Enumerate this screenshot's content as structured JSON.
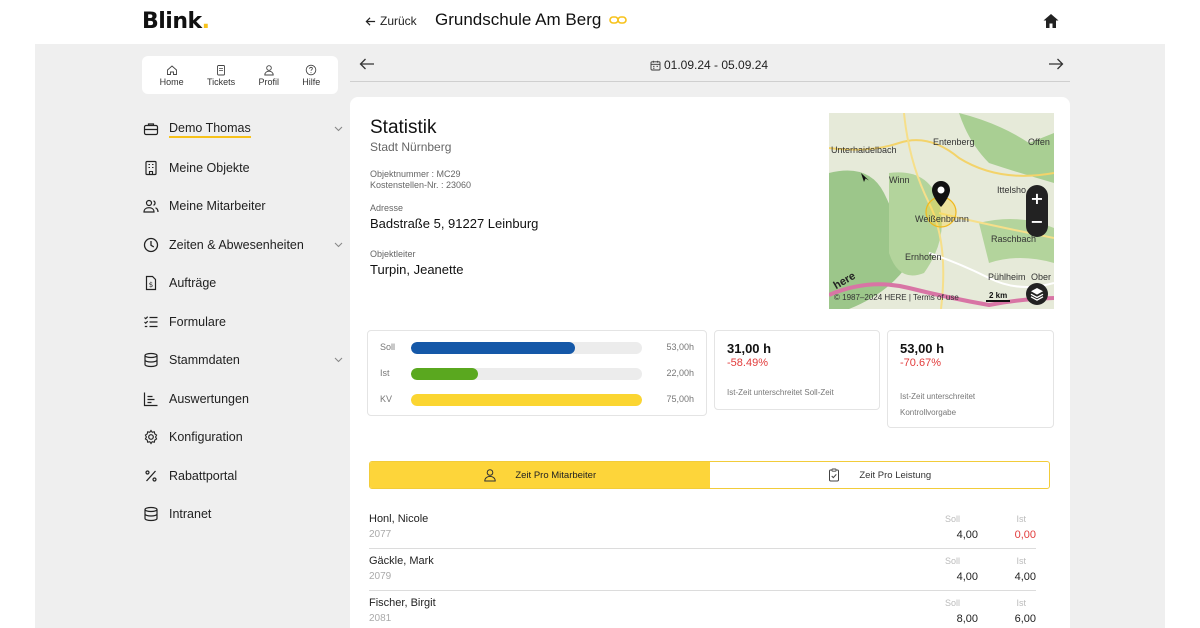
{
  "header": {
    "logo_text": "Blink",
    "logo_dot": ".",
    "back_label": "Zurück",
    "title": "Grundschule Am Berg"
  },
  "quicknav": [
    {
      "label": "Home",
      "icon": "home-icon"
    },
    {
      "label": "Tickets",
      "icon": "tickets-icon"
    },
    {
      "label": "Profil",
      "icon": "profile-icon"
    },
    {
      "label": "Hilfe",
      "icon": "help-icon"
    }
  ],
  "sidebar": {
    "items": [
      {
        "label": "Demo Thomas",
        "icon": "briefcase-icon",
        "expandable": true,
        "active": true
      },
      {
        "label": "Meine Objekte",
        "icon": "building-icon"
      },
      {
        "label": "Meine Mitarbeiter",
        "icon": "users-icon"
      },
      {
        "label": "Zeiten & Abwesenheiten",
        "icon": "clock-icon",
        "expandable": true
      },
      {
        "label": "Aufträge",
        "icon": "invoice-icon"
      },
      {
        "label": "Formulare",
        "icon": "checklist-icon"
      },
      {
        "label": "Stammdaten",
        "icon": "database-icon",
        "expandable": true
      },
      {
        "label": "Auswertungen",
        "icon": "chart-icon"
      },
      {
        "label": "Konfiguration",
        "icon": "gear-icon"
      },
      {
        "label": "Rabattportal",
        "icon": "percent-icon"
      },
      {
        "label": "Intranet",
        "icon": "database-icon"
      }
    ]
  },
  "week": {
    "range": "01.09.24 - 05.09.24"
  },
  "statistik": {
    "title": "Statistik",
    "subtitle": "Stadt Nürnberg",
    "objektnummer": "Objektnummer : MC29",
    "kostenstelle": "Kostenstellen-Nr. : 23060",
    "address_label": "Adresse",
    "address": "Badstraße 5, 91227 Leinburg",
    "leader_label": "Objektleiter",
    "leader": "Turpin, Jeanette"
  },
  "map": {
    "labels": [
      "Unterhaidelbach",
      "Entenberg",
      "Offen",
      "Winn",
      "Ittelsho",
      "Weißenbrunn",
      "Raschbach",
      "Ernhofen",
      "Pühlheim",
      "Ober"
    ],
    "copyright": "© 1987–2024 HERE | Terms of use",
    "scale": "2 km",
    "brand": "here",
    "zoom_in": "+",
    "zoom_out": "−"
  },
  "bars": [
    {
      "label": "Soll",
      "value": "53,00h",
      "fraction": 0.71,
      "color": "#1558a8"
    },
    {
      "label": "Ist",
      "value": "22,00h",
      "fraction": 0.29,
      "color": "#5aa81f"
    },
    {
      "label": "KV",
      "value": "75,00h",
      "fraction": 1.0,
      "color": "#fbd531"
    }
  ],
  "kpis": [
    {
      "value": "31,00 h",
      "pct": "-58.49%",
      "desc": "Ist-Zeit unterschreitet Soll-Zeit"
    },
    {
      "value": "53,00 h",
      "pct": "-70.67%",
      "desc": "Ist-Zeit unterschreitet Kontrollvorgabe"
    }
  ],
  "tabs": [
    {
      "label": "Zeit Pro Mitarbeiter",
      "icon": "user-icon",
      "active": true
    },
    {
      "label": "Zeit Pro Leistung",
      "icon": "clipboard-check-icon",
      "active": false
    }
  ],
  "employees": {
    "soll_header": "Soll",
    "ist_header": "Ist",
    "rows": [
      {
        "name": "Honl, Nicole",
        "id": "2077",
        "soll": "4,00",
        "ist": "0,00",
        "ist_negative": true
      },
      {
        "name": "Gäckle, Mark",
        "id": "2079",
        "soll": "4,00",
        "ist": "4,00",
        "ist_negative": false
      },
      {
        "name": "Fischer, Birgit",
        "id": "2081",
        "soll": "8,00",
        "ist": "6,00",
        "ist_negative": false
      }
    ]
  }
}
